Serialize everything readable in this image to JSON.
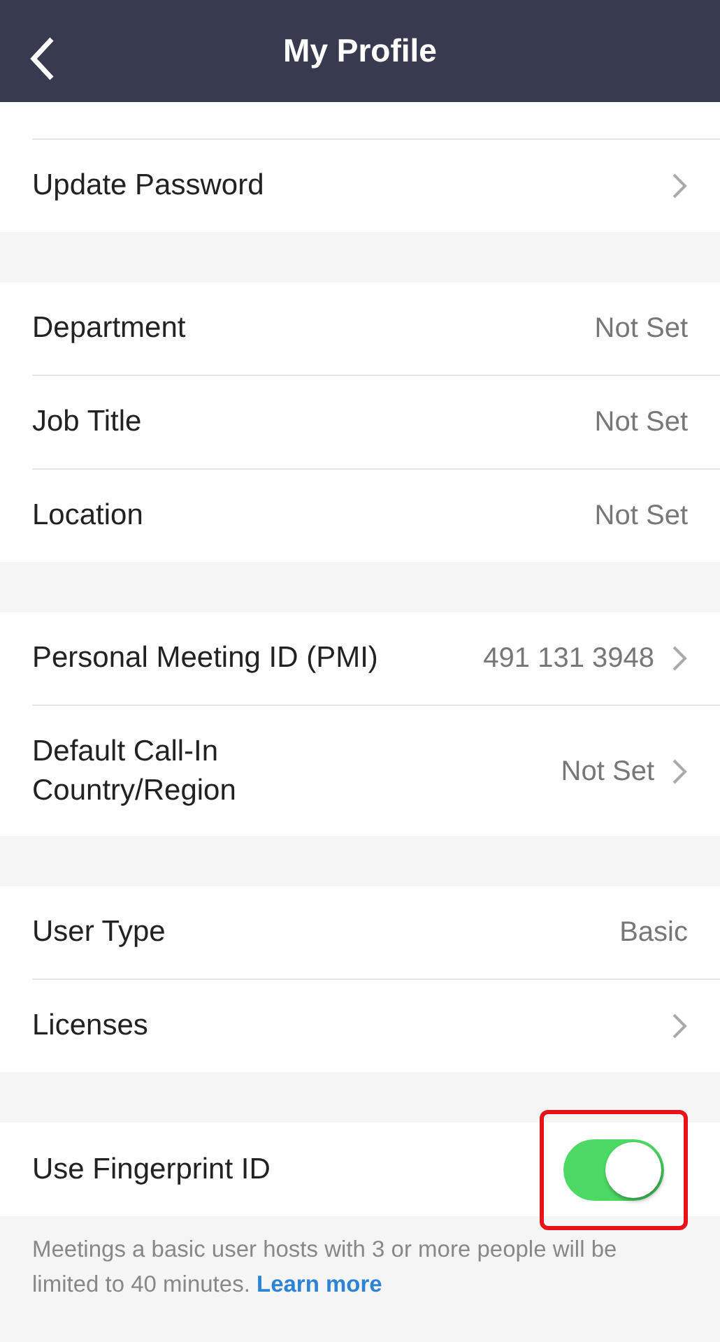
{
  "header": {
    "title": "My Profile"
  },
  "sections": [
    {
      "rows": [
        {
          "kind": "cut"
        },
        {
          "kind": "nav",
          "label": "Update Password",
          "chevron": true
        }
      ]
    },
    {
      "rows": [
        {
          "kind": "nav",
          "label": "Department",
          "value": "Not Set",
          "chevron": false
        },
        {
          "kind": "nav",
          "label": "Job Title",
          "value": "Not Set",
          "chevron": false
        },
        {
          "kind": "nav",
          "label": "Location",
          "value": "Not Set",
          "chevron": false
        }
      ]
    },
    {
      "rows": [
        {
          "kind": "nav",
          "label": "Personal Meeting ID (PMI)",
          "value": "491 131 3948",
          "chevron": true
        },
        {
          "kind": "nav",
          "label": "Default Call-In Country/Region",
          "value": "Not Set",
          "chevron": true
        }
      ]
    },
    {
      "rows": [
        {
          "kind": "nav",
          "label": "User Type",
          "value": "Basic",
          "chevron": false
        },
        {
          "kind": "nav",
          "label": "Licenses",
          "chevron": true
        }
      ]
    },
    {
      "rows": [
        {
          "kind": "toggle",
          "label": "Use Fingerprint ID",
          "on": true,
          "highlighted": true
        }
      ]
    }
  ],
  "note": {
    "text": "Meetings a basic user hosts with 3 or more people will be limited to 40 minutes.",
    "link": "Learn more"
  }
}
